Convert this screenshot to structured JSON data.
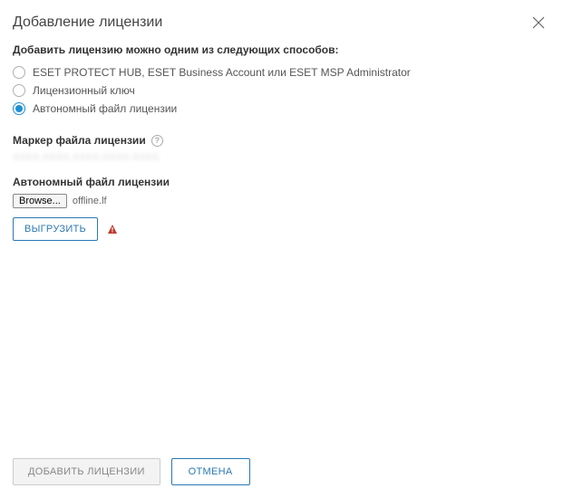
{
  "header": {
    "title": "Добавление лицензии"
  },
  "intro": {
    "heading": "Добавить лицензию можно одним из следующих способов:"
  },
  "radios": {
    "options": [
      {
        "label": "ESET PROTECT HUB, ESET Business Account или ESET MSP Administrator",
        "checked": false
      },
      {
        "label": "Лицензионный ключ",
        "checked": false
      },
      {
        "label": "Автономный файл лицензии",
        "checked": true
      }
    ]
  },
  "token": {
    "heading": "Маркер файла лицензии",
    "placeholder_blur": "XXXX-XXXX-XXXX-XXXX-XXXX"
  },
  "filepick": {
    "heading": "Автономный файл лицензии",
    "browse_label": "Browse...",
    "filename": "offline.lf"
  },
  "upload": {
    "button_label": "ВЫГРУЗИТЬ"
  },
  "footer": {
    "add_label": "ДОБАВИТЬ ЛИЦЕНЗИИ",
    "cancel_label": "ОТМЕНА"
  }
}
